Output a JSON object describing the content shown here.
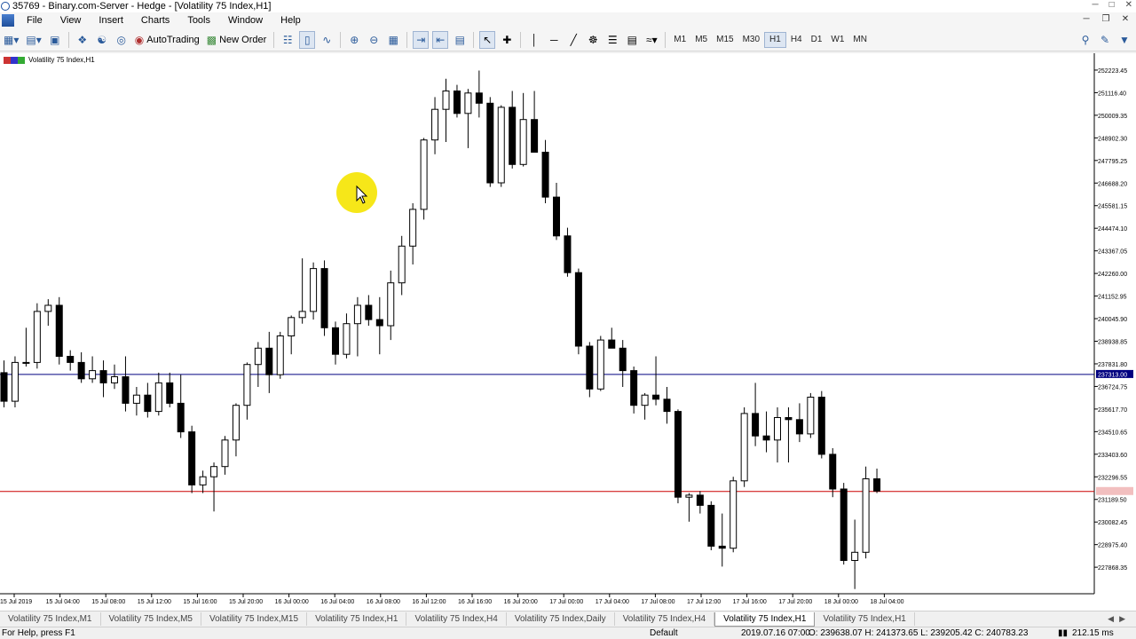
{
  "window": {
    "title": "35769 - Binary.com-Server - Hedge - [Volatility 75 Index,H1]"
  },
  "menu": [
    "File",
    "View",
    "Insert",
    "Charts",
    "Tools",
    "Window",
    "Help"
  ],
  "toolbar": {
    "autotrading_label": "AutoTrading",
    "new_order_label": "New Order",
    "timeframes": [
      "M1",
      "M5",
      "M15",
      "M30",
      "H1",
      "H4",
      "D1",
      "W1",
      "MN"
    ],
    "active_timeframe": "H1"
  },
  "chart": {
    "label": "Volatility 75 Index,H1",
    "line_colors": {
      "bid": "#000080",
      "ask": "#cc0000",
      "candle": "#000000"
    }
  },
  "chart_data": {
    "type": "candlestick",
    "symbol": "Volatility 75 Index",
    "timeframe": "H1",
    "ylim": [
      226700,
      252700
    ],
    "yticks": [
      "252223.45",
      "251116.40",
      "250009.35",
      "248902.30",
      "247795.25",
      "246688.20",
      "245581.15",
      "244474.10",
      "243367.05",
      "242260.00",
      "241152.95",
      "240045.90",
      "238938.85",
      "237831.80",
      "236724.75",
      "235617.70",
      "234510.65",
      "233403.60",
      "232296.55",
      "231189.50",
      "230082.45",
      "228975.40",
      "227868.35"
    ],
    "xticks": [
      "15 Jul 2019",
      "15 Jul 04:00",
      "15 Jul 08:00",
      "15 Jul 12:00",
      "15 Jul 16:00",
      "15 Jul 20:00",
      "16 Jul 00:00",
      "16 Jul 04:00",
      "16 Jul 08:00",
      "16 Jul 12:00",
      "16 Jul 16:00",
      "16 Jul 20:00",
      "17 Jul 00:00",
      "17 Jul 04:00",
      "17 Jul 08:00",
      "17 Jul 12:00",
      "17 Jul 16:00",
      "17 Jul 20:00",
      "18 Jul 00:00",
      "18 Jul 04:00"
    ],
    "bid_line": 237313.0,
    "bid_label": "237313.00",
    "ask_line": 231580,
    "candles": [
      [
        237400,
        238000,
        235700,
        236000
      ],
      [
        236000,
        238200,
        235700,
        237900
      ],
      [
        237900,
        239600,
        237700,
        237900
      ],
      [
        237900,
        240800,
        237600,
        240400
      ],
      [
        240400,
        241000,
        239700,
        240700
      ],
      [
        240700,
        241100,
        237800,
        238200
      ],
      [
        238200,
        238500,
        237500,
        237900
      ],
      [
        237900,
        238400,
        236900,
        237100
      ],
      [
        237100,
        238200,
        236900,
        237500
      ],
      [
        237500,
        238000,
        236200,
        236900
      ],
      [
        236900,
        237800,
        236600,
        237200
      ],
      [
        237200,
        238200,
        235500,
        235900
      ],
      [
        235900,
        236700,
        235300,
        236300
      ],
      [
        236300,
        236900,
        235200,
        235500
      ],
      [
        235500,
        237400,
        235300,
        236900
      ],
      [
        236900,
        237400,
        235700,
        235900
      ],
      [
        235900,
        237300,
        234200,
        234500
      ],
      [
        234500,
        234800,
        231500,
        231900
      ],
      [
        231900,
        232600,
        231500,
        232300
      ],
      [
        232300,
        233000,
        230600,
        232800
      ],
      [
        232800,
        234300,
        232400,
        234100
      ],
      [
        234100,
        235900,
        233300,
        235800
      ],
      [
        235800,
        237900,
        235100,
        237800
      ],
      [
        237800,
        238900,
        236700,
        238600
      ],
      [
        238600,
        239400,
        236400,
        237300
      ],
      [
        237300,
        239400,
        237100,
        239200
      ],
      [
        239200,
        240200,
        238300,
        240100
      ],
      [
        240100,
        243000,
        239800,
        240400
      ],
      [
        240400,
        242800,
        240000,
        242500
      ],
      [
        242500,
        242900,
        239200,
        239600
      ],
      [
        239600,
        239900,
        237800,
        238300
      ],
      [
        238300,
        240300,
        238100,
        239800
      ],
      [
        239800,
        241100,
        238200,
        240700
      ],
      [
        240700,
        241200,
        239700,
        240000
      ],
      [
        240000,
        241100,
        238300,
        239700
      ],
      [
        239700,
        242400,
        239000,
        241800
      ],
      [
        241800,
        244100,
        241200,
        243600
      ],
      [
        243600,
        245700,
        242700,
        245400
      ],
      [
        245400,
        248900,
        244900,
        248800
      ],
      [
        248800,
        250900,
        248100,
        250300
      ],
      [
        250300,
        251800,
        248700,
        251200
      ],
      [
        251200,
        251500,
        249900,
        250100
      ],
      [
        250100,
        251300,
        248400,
        251100
      ],
      [
        251100,
        252200,
        249900,
        250600
      ],
      [
        250600,
        250900,
        246500,
        246700
      ],
      [
        246700,
        250500,
        246500,
        250400
      ],
      [
        250400,
        251200,
        247400,
        247600
      ],
      [
        247600,
        251100,
        247500,
        249800
      ],
      [
        249800,
        251200,
        248400,
        248200
      ],
      [
        248200,
        248800,
        245700,
        246000
      ],
      [
        246000,
        246700,
        243900,
        244100
      ],
      [
        244100,
        244500,
        242100,
        242300
      ],
      [
        242300,
        242500,
        238300,
        238700
      ],
      [
        238700,
        238900,
        236200,
        236600
      ],
      [
        236600,
        239200,
        236500,
        239000
      ],
      [
        239000,
        239600,
        238600,
        238600
      ],
      [
        238600,
        239000,
        236700,
        237500
      ],
      [
        237500,
        237700,
        235400,
        235800
      ],
      [
        235800,
        236400,
        235100,
        236300
      ],
      [
        236300,
        238200,
        235800,
        236100
      ],
      [
        236100,
        236700,
        234900,
        235500
      ],
      [
        235500,
        235600,
        231000,
        231300
      ],
      [
        231300,
        231500,
        230100,
        231400
      ],
      [
        231400,
        231600,
        230500,
        230900
      ],
      [
        230900,
        231100,
        228700,
        228900
      ],
      [
        228900,
        230500,
        227900,
        228800
      ],
      [
        228800,
        232300,
        228600,
        232100
      ],
      [
        232100,
        235700,
        231800,
        235400
      ],
      [
        235400,
        236900,
        233800,
        234300
      ],
      [
        234300,
        235500,
        233500,
        234100
      ],
      [
        234100,
        235700,
        233000,
        235200
      ],
      [
        235200,
        235700,
        233000,
        235100
      ],
      [
        235100,
        235900,
        234000,
        234400
      ],
      [
        234400,
        236400,
        234200,
        236200
      ],
      [
        236200,
        236500,
        233200,
        233400
      ],
      [
        233400,
        233700,
        231300,
        231700
      ],
      [
        231700,
        232000,
        228000,
        228200
      ],
      [
        228200,
        230200,
        226800,
        228600
      ],
      [
        228600,
        232800,
        228300,
        232200
      ],
      [
        232200,
        232700,
        231500,
        231600
      ]
    ]
  },
  "tabs": [
    "Volatility 75 Index,M1",
    "Volatility 75 Index,M5",
    "Volatility 75 Index,M15",
    "Volatility 75 Index,H1",
    "Volatility 75 Index,H4",
    "Volatility 75 Index,Daily",
    "Volatility 75 Index,H4",
    "Volatility 75 Index,H1",
    "Volatility 75 Index,H1"
  ],
  "active_tab_index": 7,
  "statusbar": {
    "help": "For Help, press F1",
    "profile": "Default",
    "datetime": "2019.07.16 07:00",
    "ohlc": "O: 239638.07  H: 241373.65  L: 239205.42  C: 240783.23",
    "ping": "212.15 ms"
  }
}
